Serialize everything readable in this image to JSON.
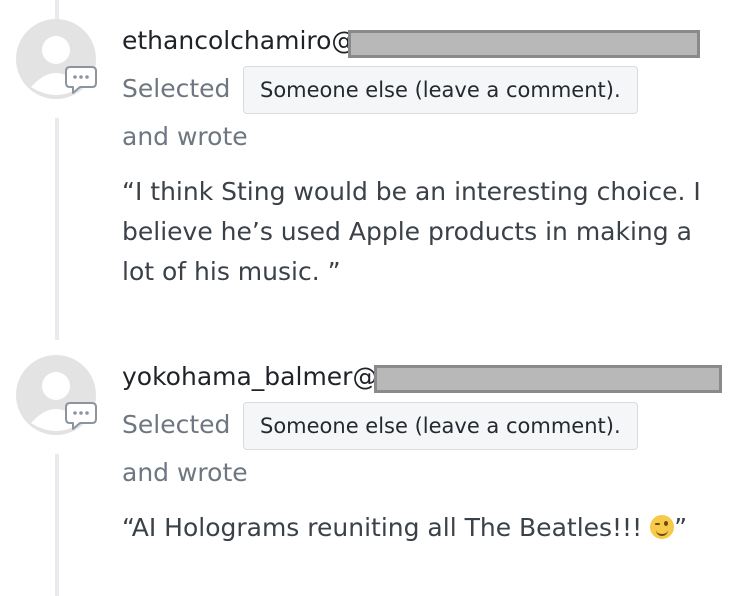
{
  "comments": [
    {
      "username": "ethancolchamiro@",
      "selected_label": "Selected",
      "choice": "Someone else (leave a comment).",
      "wrote_label": "and wrote",
      "text": "“I think Sting would be an interesting choice. I believe he’s used Apple products in making a lot of his music. ”"
    },
    {
      "username": "yokohama_balmer@",
      "selected_label": "Selected",
      "choice": "Someone else (leave a comment).",
      "wrote_label": "and wrote",
      "text_before_emoji": "“AI Holograms reuniting all The Beatles!!! ",
      "emoji_icon": "winking-face-icon",
      "text_after_emoji": "”"
    }
  ],
  "colors": {
    "timeline": "#e8eaed",
    "avatar": "#e3e3e3",
    "redaction": "#b8b8b8",
    "pill_background": "#f5f6f8"
  }
}
